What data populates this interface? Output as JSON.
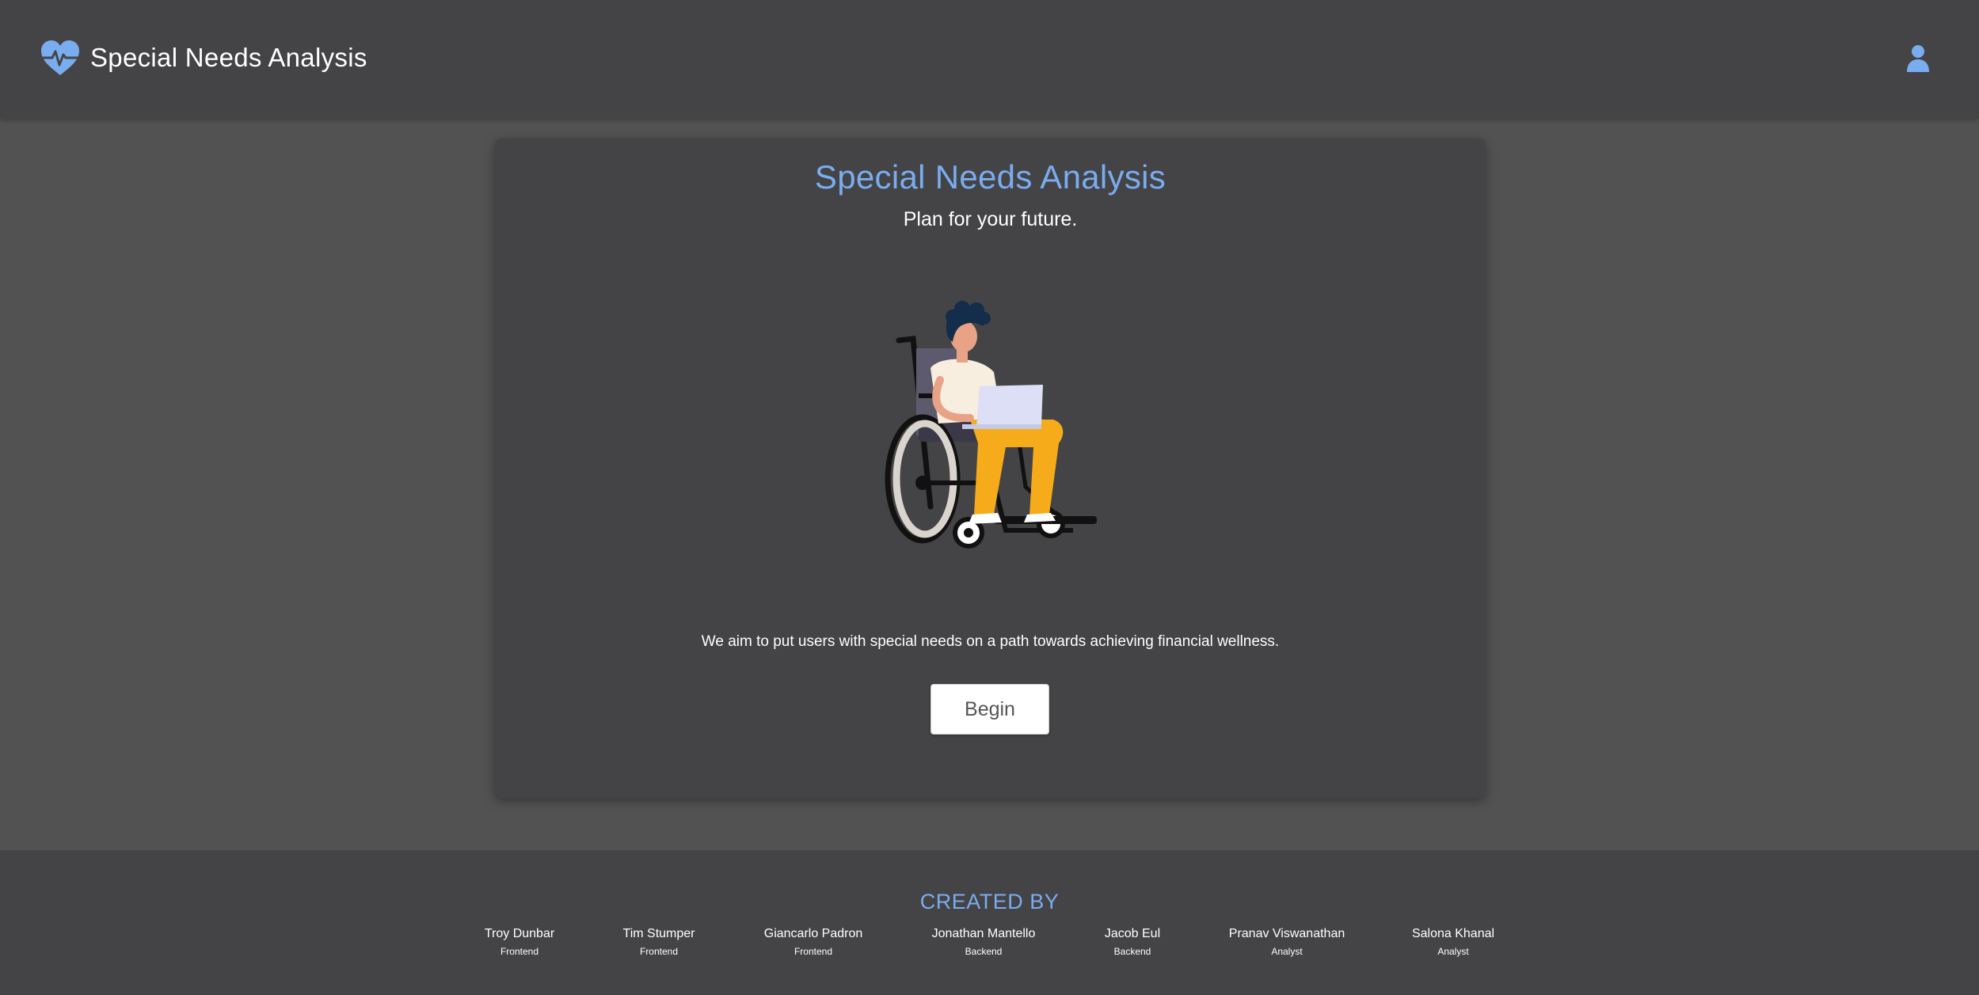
{
  "header": {
    "app_name": "Special Needs Analysis",
    "logo_icon": "heart-pulse-icon",
    "user_icon": "user-icon",
    "accent_color": "#7aacf0"
  },
  "hero": {
    "title": "Special Needs Analysis",
    "subtitle": "Plan for your future.",
    "description": "We aim to put users with special needs on a path towards achieving financial wellness.",
    "begin_label": "Begin",
    "illustration": "person-in-wheelchair-with-laptop"
  },
  "footer": {
    "heading": "CREATED BY",
    "creators": [
      {
        "name": "Troy Dunbar",
        "role": "Frontend"
      },
      {
        "name": "Tim Stumper",
        "role": "Frontend"
      },
      {
        "name": "Giancarlo Padron",
        "role": "Frontend"
      },
      {
        "name": "Jonathan Mantello",
        "role": "Backend"
      },
      {
        "name": "Jacob Eul",
        "role": "Backend"
      },
      {
        "name": "Pranav Viswanathan",
        "role": "Analyst"
      },
      {
        "name": "Salona Khanal",
        "role": "Analyst"
      }
    ]
  }
}
